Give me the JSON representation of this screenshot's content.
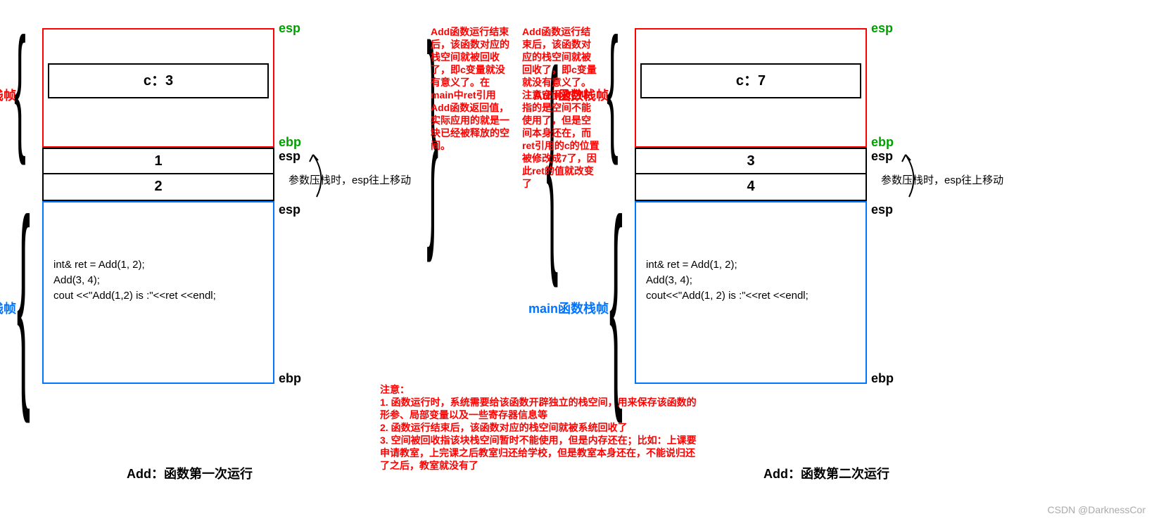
{
  "left": {
    "add_label": "Add函数栈帧",
    "main_label": "main函数栈帧",
    "c_value": "c：3",
    "param1": "1",
    "param2": "2",
    "esp_top": "esp",
    "ebp_add": "ebp",
    "esp_params_top": "esp",
    "esp_params_bottom": "esp",
    "ebp_main": "ebp",
    "annot": "参数压栈时，esp往上移动",
    "code_line1": "int& ret = Add(1, 2);",
    "code_line2": "Add(3, 4);",
    "code_line3": "cout <<\"Add(1,2) is :\"<<ret <<endl;",
    "caption": "Add：函数第一次运行"
  },
  "right": {
    "add_label": "Add函数栈帧",
    "main_label": "main函数栈帧",
    "c_value": "c：7",
    "param1": "3",
    "param2": "4",
    "esp_top": "esp",
    "ebp_add": "ebp",
    "esp_params_top": "esp",
    "esp_params_bottom": "esp",
    "ebp_main": "ebp",
    "annot": "参数压栈时，esp往上移动",
    "code_line1": "int& ret = Add(1, 2);",
    "code_line2": "Add(3, 4);",
    "code_line3": "cout<<\"Add(1, 2) is :\"<<ret <<endl;",
    "caption": "Add：函数第二次运行"
  },
  "middle1": "Add函数运行结束后，该函数对应的栈空间就被回收了，即c变量就没有意义了。在main中ret引用Add函数返回值，实际应用的就是一块已经被释放的空间。",
  "middle2": "Add函数运行结束后，该函数对应的栈空间就被回收了，即c变量就没有意义了。注意空间被回收指的是空间不能使用了，但是空间本身还在，而ret引用的c的位置被修改成7了，因此ret的值就改变了",
  "note_title": "注意：",
  "note1": "1. 函数运行时，系统需要给该函数开辟独立的栈空间，用来保存该函数的形参、局部变量以及一些寄存器信息等",
  "note2": "2. 函数运行结束后，该函数对应的栈空间就被系统回收了",
  "note3": "3. 空间被回收指该块栈空间暂时不能使用，但是内存还在；比如：上课要申请教室，上完课之后教室归还给学校，但是教室本身还在，不能说归还了之后，教室就没有了",
  "watermark": "CSDN @DarknessCor"
}
